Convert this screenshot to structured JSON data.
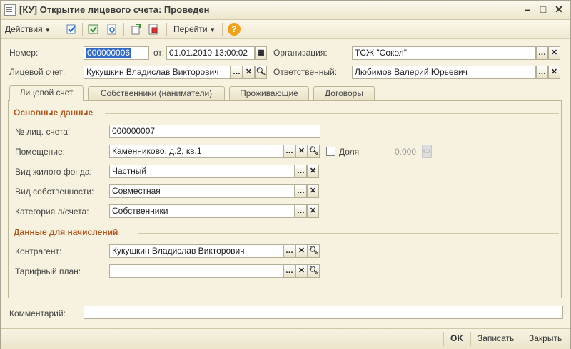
{
  "window": {
    "title": "[КУ] Открытие лицевого счета: Проведен"
  },
  "toolbar": {
    "actions": "Действия",
    "goto": "Перейти",
    "help": "?"
  },
  "header": {
    "number_label": "Номер:",
    "number_value": "000000006",
    "date_label": "от:",
    "date_value": "01.01.2010 13:00:02",
    "org_label": "Организация:",
    "org_value": "ТСЖ \"Сокол\"",
    "account_label": "Лицевой счет:",
    "account_value": "Кукушкин Владислав Викторович",
    "responsible_label": "Ответственный:",
    "responsible_value": "Любимов Валерий Юрьевич"
  },
  "tabs": [
    {
      "label": "Лицевой счет"
    },
    {
      "label": "Собственники (наниматели)"
    },
    {
      "label": "Проживающие"
    },
    {
      "label": "Договоры"
    }
  ],
  "main": {
    "section1": "Основные данные",
    "account_no_label": "№ лиц. счета:",
    "account_no_value": "000000007",
    "premises_label": "Помещение:",
    "premises_value": "Каменниково, д.2, кв.1",
    "share_label": "Доля",
    "share_value": "0.000",
    "fund_label": "Вид жилого фонда:",
    "fund_value": "Частный",
    "ownership_label": "Вид собственности:",
    "ownership_value": "Совместная",
    "category_label": "Категория л/счета:",
    "category_value": "Собственники",
    "section2": "Данные для начислений",
    "contractor_label": "Контрагент:",
    "contractor_value": "Кукушкин Владислав Викторович",
    "tariff_label": "Тарифный план:",
    "tariff_value": ""
  },
  "footer": {
    "comment_label": "Комментарий:",
    "comment_value": "",
    "ok": "OK",
    "save": "Записать",
    "close": "Закрыть"
  }
}
